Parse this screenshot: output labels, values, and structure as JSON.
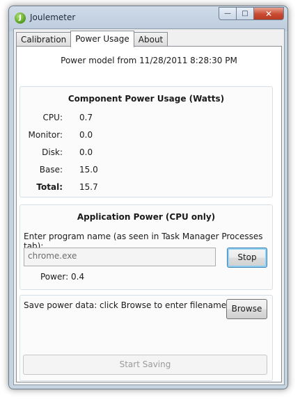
{
  "window": {
    "title": "Joulemeter",
    "icon": "joulemeter-app-icon",
    "controls": {
      "minimize_glyph": "—",
      "maximize_glyph": "□",
      "close_glyph": "✕"
    }
  },
  "tabs": [
    {
      "label": "Calibration",
      "active": false
    },
    {
      "label": "Power Usage",
      "active": true
    },
    {
      "label": "About",
      "active": false
    }
  ],
  "power_usage": {
    "model_line": "Power model from 11/28/2011 8:28:30 PM",
    "component": {
      "title": "Component Power Usage (Watts)",
      "rows": [
        {
          "label": "CPU:",
          "value": "0.7"
        },
        {
          "label": "Monitor:",
          "value": "0.0"
        },
        {
          "label": "Disk:",
          "value": "0.0"
        },
        {
          "label": "Base:",
          "value": "15.0"
        },
        {
          "label": "Total:",
          "value": "15.7"
        }
      ]
    },
    "application": {
      "title": "Application Power (CPU only)",
      "prompt": "Enter program name (as seen in Task Manager Processes tab):",
      "program_value": "chrome.exe",
      "stop_label": "Stop",
      "power_label": "Power:",
      "power_value": "0.4"
    },
    "save": {
      "text": "Save power data: click Browse to enter filename.",
      "browse_label": "Browse",
      "start_label": "Start Saving"
    }
  },
  "colors": {
    "window_frame": "#c6d3e1",
    "close_button": "#c94b32",
    "focused_button_border": "#3c7fb1"
  }
}
